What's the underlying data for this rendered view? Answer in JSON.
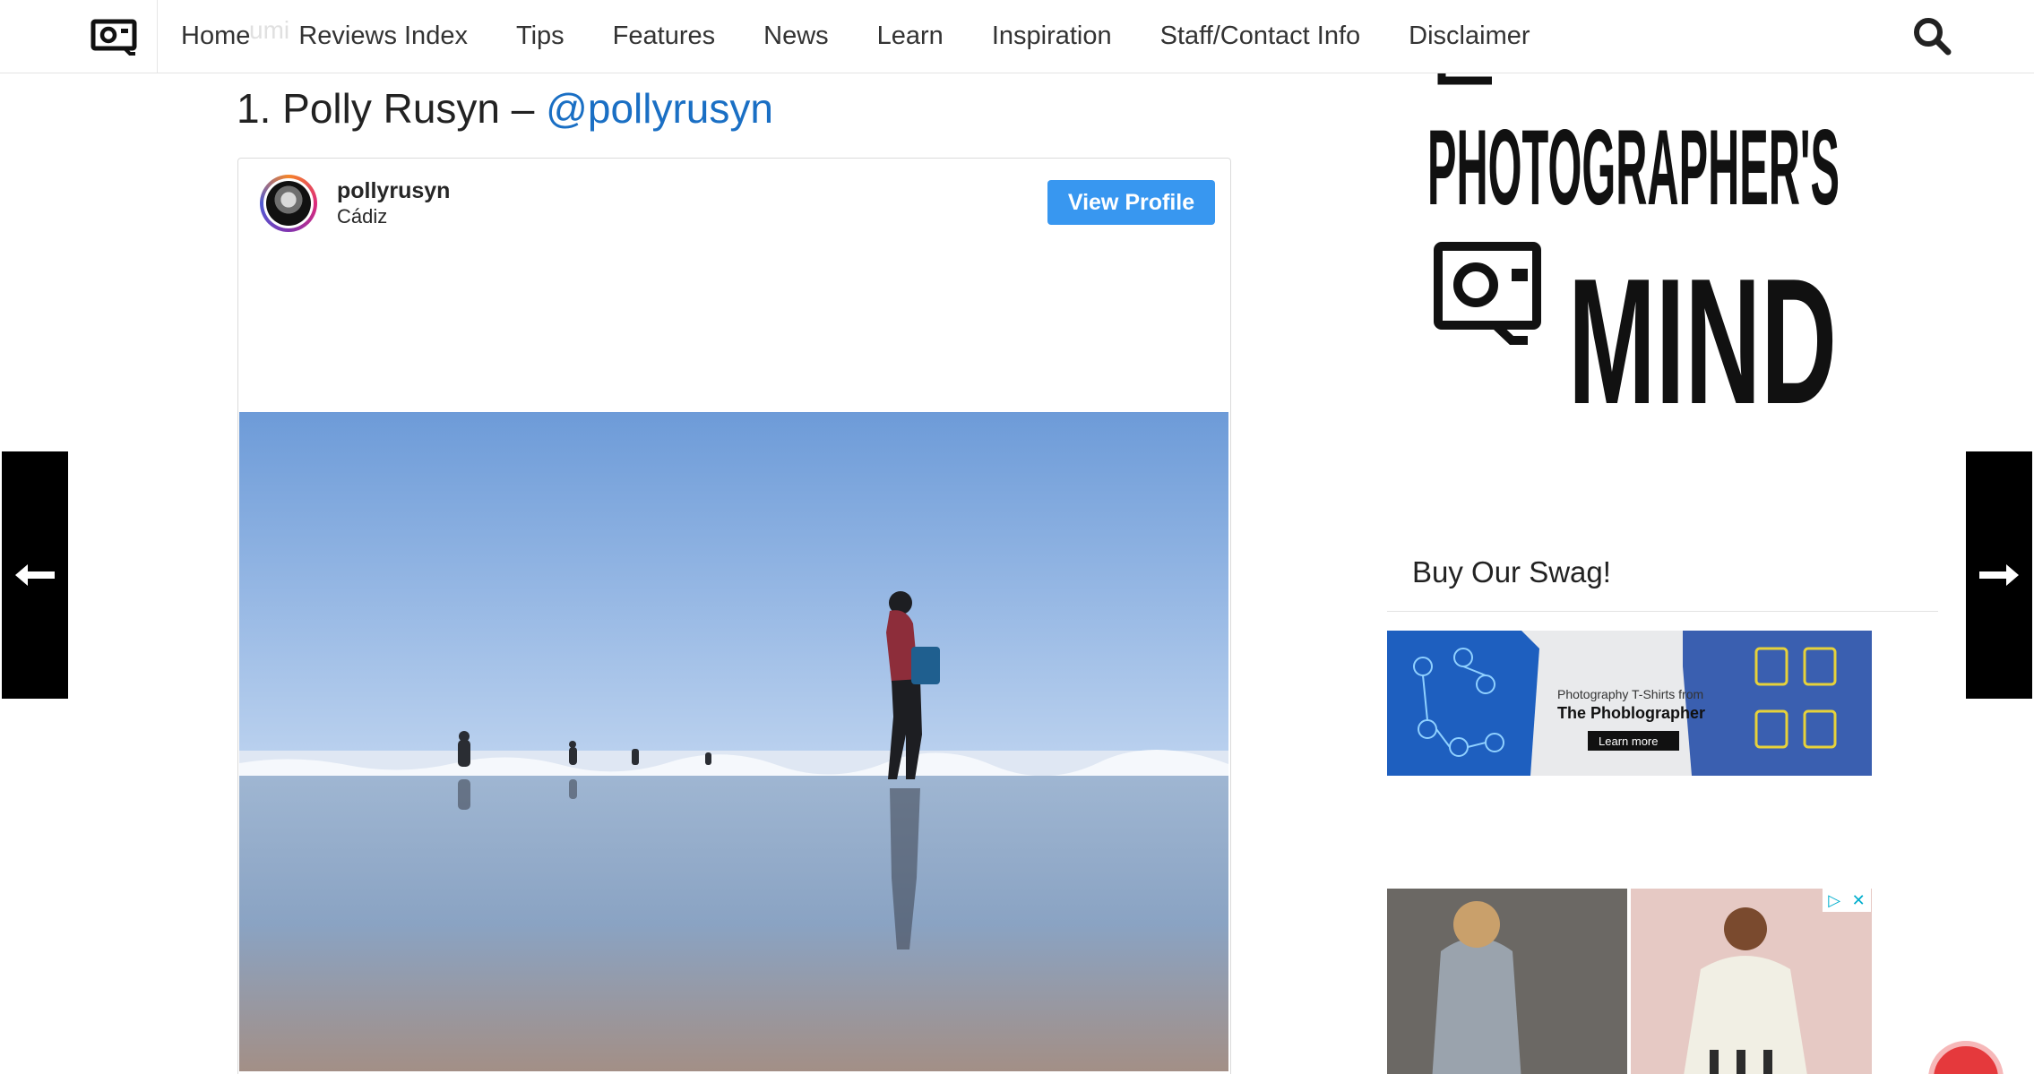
{
  "nav": {
    "items": [
      {
        "label": "Home"
      },
      {
        "label": "Reviews Index"
      },
      {
        "label": "Tips"
      },
      {
        "label": "Features"
      },
      {
        "label": "News"
      },
      {
        "label": "Learn"
      },
      {
        "label": "Inspiration"
      },
      {
        "label": "Staff/Contact Info"
      },
      {
        "label": "Disclaimer"
      }
    ],
    "ghost_text": "umi"
  },
  "article": {
    "heading_prefix": "1. Polly Rusyn – ",
    "heading_handle": "@pollyrusyn"
  },
  "instagram_embed": {
    "username": "pollyrusyn",
    "location": "Cádiz",
    "view_profile_label": "View Profile"
  },
  "sidebar": {
    "banner_lines": [
      "PHOTOGRAPHER'S",
      "MIND"
    ],
    "swag_title": "Buy Our Swag!",
    "swag_ad": {
      "line1": "Photography T-Shirts from",
      "line2": "The Phoblographer",
      "cta": "Learn more"
    }
  },
  "colors": {
    "accent_link": "#1a6fc4",
    "instagram_button": "#3897f0",
    "swag_ad_blue": "#1e5fbf",
    "fab_red": "#e5393c"
  }
}
